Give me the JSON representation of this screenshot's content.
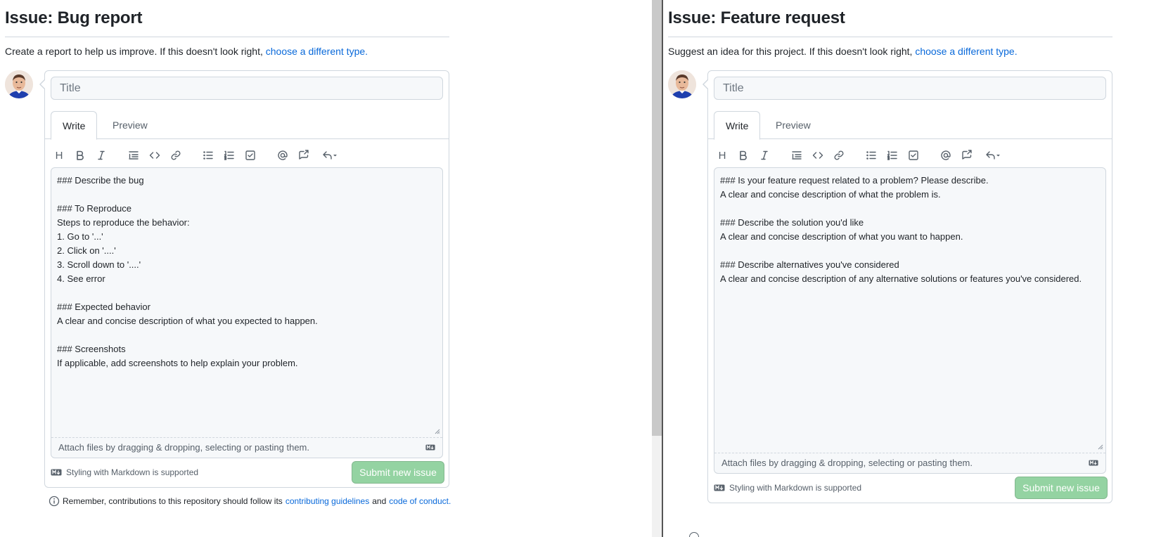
{
  "left": {
    "heading": "Issue: Bug report",
    "description_prefix": "Create a report to help us improve. If this doesn't look right,",
    "description_link": "choose a different type.",
    "title_placeholder": "Title",
    "tabs": [
      {
        "label": "Write"
      },
      {
        "label": "Preview"
      }
    ],
    "body": "### Describe the bug\n\n### To Reproduce\nSteps to reproduce the behavior:\n1. Go to '...'\n2. Click on '....'\n3. Scroll down to '....'\n4. See error\n\n### Expected behavior\nA clear and concise description of what you expected to happen.\n\n### Screenshots\nIf applicable, add screenshots to help explain your problem.",
    "attach_text": "Attach files by dragging & dropping, selecting or pasting them.",
    "markdown_note": "Styling with Markdown is supported",
    "submit_label": "Submit new issue",
    "remember_prefix": "Remember, contributions to this repository should follow its",
    "contrib_link": "contributing guidelines",
    "and_text": "and",
    "coc_link": "code of conduct."
  },
  "right": {
    "heading": "Issue: Feature request",
    "description_prefix": "Suggest an idea for this project. If this doesn't look right,",
    "description_link": "choose a different type.",
    "title_placeholder": "Title",
    "tabs": [
      {
        "label": "Write"
      },
      {
        "label": "Preview"
      }
    ],
    "body": "### Is your feature request related to a problem? Please describe.\nA clear and concise description of what the problem is.\n\n### Describe the solution you'd like\nA clear and concise description of what you want to happen.\n\n### Describe alternatives you've considered\nA clear and concise description of any alternative solutions or features you've considered.",
    "attach_text": "Attach files by dragging & dropping, selecting or pasting them.",
    "markdown_note": "Styling with Markdown is supported",
    "submit_label": "Submit new issue"
  },
  "toolbar_icons": [
    "heading-icon",
    "bold-icon",
    "italic-icon",
    "quote-icon",
    "code-icon",
    "link-icon",
    "bulleted-list-icon",
    "numbered-list-icon",
    "task-list-icon",
    "mention-icon",
    "cross-reference-icon",
    "saved-replies-icon"
  ],
  "colors": {
    "link": "#0969da",
    "submit_disabled": "#94d3a2",
    "border": "#d0d7de",
    "editor_bg": "#f6f8fa"
  }
}
